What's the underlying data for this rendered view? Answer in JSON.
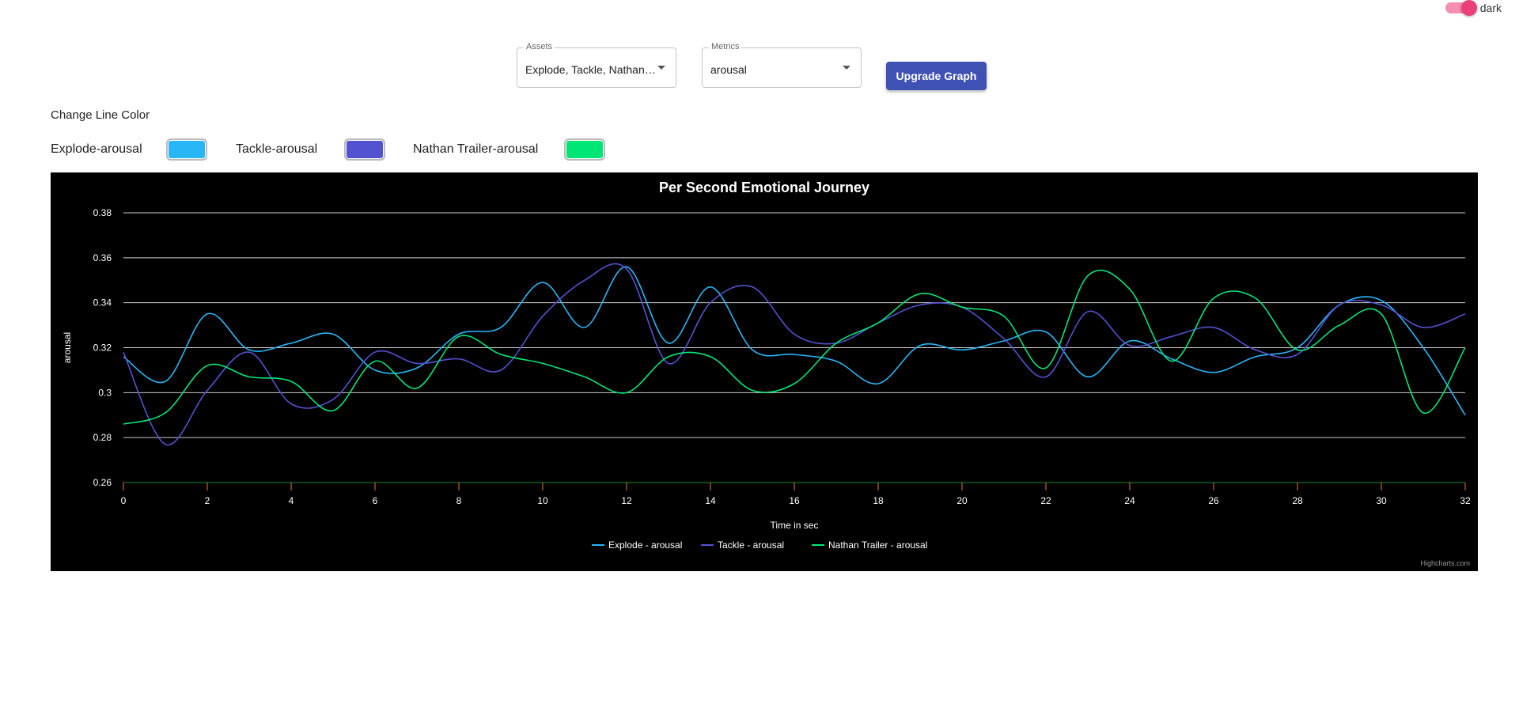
{
  "theme_toggle": {
    "label": "dark",
    "on": true,
    "color": "#ec407a"
  },
  "controls": {
    "assets": {
      "label": "Assets",
      "value": "Explode, Tackle, Nathan ..."
    },
    "metrics": {
      "label": "Metrics",
      "value": "arousal"
    },
    "upgrade_button": "Upgrade Graph"
  },
  "line_colors": {
    "heading": "Change Line Color",
    "items": [
      {
        "label": "Explode-arousal",
        "color": "#29b6f6"
      },
      {
        "label": "Tackle-arousal",
        "color": "#5352d0"
      },
      {
        "label": "Nathan Trailer-arousal",
        "color": "#00e676"
      }
    ]
  },
  "chart_data": {
    "type": "line",
    "title": "Per Second Emotional Journey",
    "xlabel": "Time in sec",
    "ylabel": "arousal",
    "xlim": [
      0,
      32
    ],
    "ylim": [
      0.26,
      0.38
    ],
    "x_ticks": [
      0,
      2,
      4,
      6,
      8,
      10,
      12,
      14,
      16,
      18,
      20,
      22,
      24,
      26,
      28,
      30,
      32
    ],
    "y_ticks": [
      0.26,
      0.28,
      0.3,
      0.32,
      0.34,
      0.36,
      0.38
    ],
    "y_tick_labels": [
      "0.26",
      "0.28",
      "0.3",
      "0.32",
      "0.34",
      "0.36",
      "0.38"
    ],
    "grid": true,
    "legend": "bottom-center",
    "background": "#000000",
    "credits": "Highcharts.com",
    "x": [
      0,
      1,
      2,
      3,
      4,
      5,
      6,
      7,
      8,
      9,
      10,
      11,
      12,
      13,
      14,
      15,
      16,
      17,
      18,
      19,
      20,
      21,
      22,
      23,
      24,
      25,
      26,
      27,
      28,
      29,
      30,
      31,
      32
    ],
    "series": [
      {
        "name": "Explode - arousal",
        "color": "#29b6f6",
        "values": [
          0.316,
          0.305,
          0.335,
          0.319,
          0.322,
          0.326,
          0.31,
          0.311,
          0.326,
          0.329,
          0.349,
          0.329,
          0.356,
          0.322,
          0.347,
          0.319,
          0.317,
          0.314,
          0.304,
          0.321,
          0.319,
          0.323,
          0.327,
          0.307,
          0.323,
          0.315,
          0.309,
          0.316,
          0.32,
          0.339,
          0.341,
          0.32,
          0.29
        ]
      },
      {
        "name": "Tackle - arousal",
        "color": "#5352d0",
        "values": [
          0.318,
          0.277,
          0.301,
          0.318,
          0.295,
          0.297,
          0.318,
          0.313,
          0.315,
          0.31,
          0.334,
          0.35,
          0.355,
          0.313,
          0.34,
          0.347,
          0.326,
          0.322,
          0.331,
          0.339,
          0.338,
          0.324,
          0.307,
          0.336,
          0.321,
          0.325,
          0.329,
          0.319,
          0.317,
          0.339,
          0.339,
          0.329,
          0.335
        ]
      },
      {
        "name": "Nathan Trailer - arousal",
        "color": "#00e676",
        "values": [
          0.286,
          0.291,
          0.312,
          0.307,
          0.305,
          0.292,
          0.314,
          0.302,
          0.325,
          0.317,
          0.313,
          0.307,
          0.3,
          0.316,
          0.316,
          0.301,
          0.304,
          0.322,
          0.331,
          0.344,
          0.338,
          0.334,
          0.311,
          0.352,
          0.346,
          0.314,
          0.342,
          0.342,
          0.319,
          0.33,
          0.335,
          0.291,
          0.32
        ]
      }
    ]
  }
}
